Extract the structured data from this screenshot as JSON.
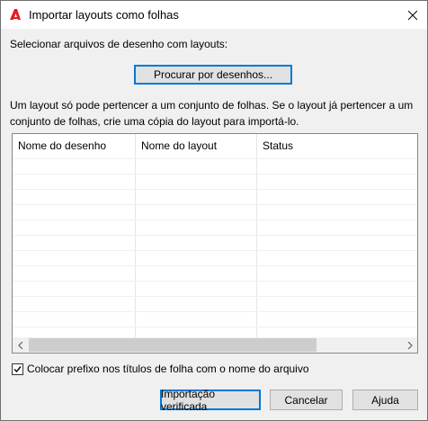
{
  "window": {
    "title": "Importar layouts como folhas"
  },
  "labels": {
    "select_files": "Selecionar arquivos de desenho com layouts:",
    "info": "Um layout só pode pertencer a um conjunto de folhas. Se o layout já pertencer a um conjunto de folhas, crie uma cópia do layout para importá-lo."
  },
  "buttons": {
    "browse": "Procurar por desenhos...",
    "import_checked": "Importação verificada",
    "cancel": "Cancelar",
    "help": "Ajuda"
  },
  "table": {
    "columns": [
      "Nome do desenho",
      "Nome do layout",
      "Status"
    ],
    "rows": []
  },
  "options": {
    "prefix_label": "Colocar prefixo nos títulos de folha com o nome do arquivo",
    "prefix_checked": true
  },
  "colors": {
    "accent": "#0078d7",
    "app_icon": "#e51a22"
  },
  "icons": {
    "app": "autocad-logo-icon",
    "close": "close-icon",
    "check": "check-icon"
  }
}
